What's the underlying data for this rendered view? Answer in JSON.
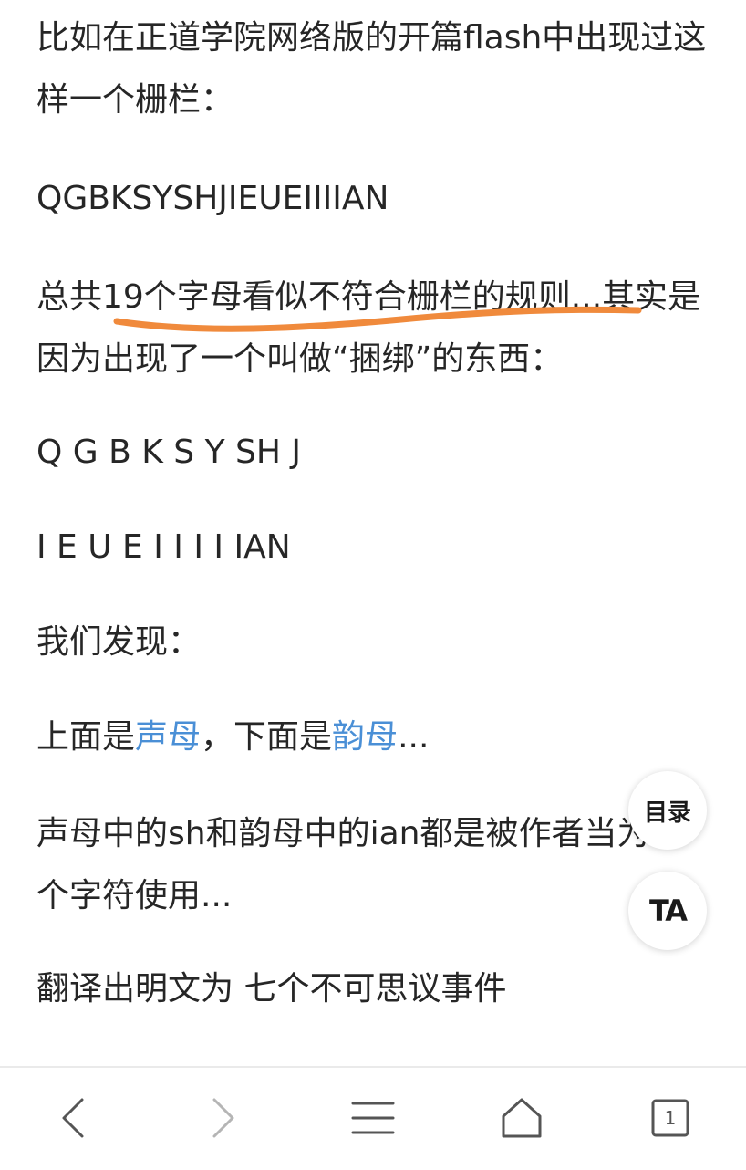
{
  "article": {
    "p1": "比如在正道学院网络版的开篇flash中出现过这样一个栅栏：",
    "p2": "QGBKSYSHJIEUEIIIIAN",
    "p3": "总共19个字母看似不符合栅栏的规则...其实是因为出现了一个叫做“捆绑”的东西：",
    "p4": "Q G B K S Y SH J",
    "p5": "I E U E I I I I IAN",
    "p6": "我们发现：",
    "p7": {
      "prefix": "上面是",
      "link1": "声母",
      "middle": "，下面是",
      "link2": "韵母",
      "suffix": "..."
    },
    "p8": "声母中的sh和韵母中的ian都是被作者当为一个字符使用...",
    "p9": "翻译出明文为 七个不可思议事件"
  },
  "floating": {
    "toc_label": "目录",
    "ta_label": "TA"
  },
  "bottom_nav": {
    "tab_count": "1"
  },
  "colors": {
    "text": "#262626",
    "link": "#4a8fd6",
    "highlight_underline": "#f08a3c",
    "icon": "#555555"
  }
}
